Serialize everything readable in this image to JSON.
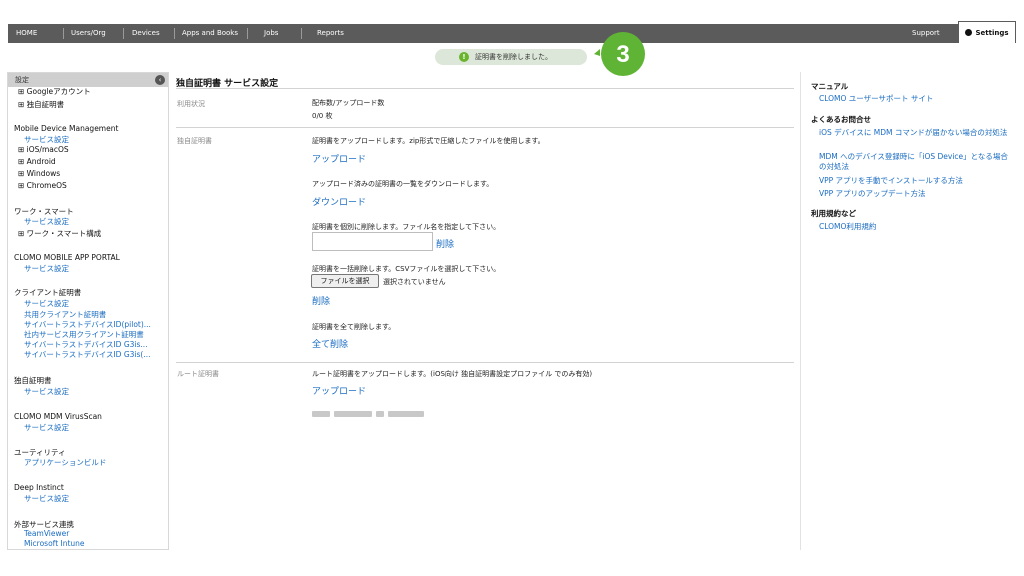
{
  "nav": {
    "items": [
      "HOME",
      "Users/Org",
      "Devices",
      "Apps and Books",
      "Jobs",
      "Reports"
    ],
    "support": "Support",
    "settings": "Settings"
  },
  "toast": {
    "message": "証明書を削除しました。",
    "step_number": "3",
    "accent": "#5fb335"
  },
  "sidebar": {
    "header": "設定",
    "lines": [
      {
        "text": "Googleアカウント",
        "kind": "tree"
      },
      {
        "text": "独自証明書",
        "kind": "tree"
      },
      {
        "text": "Mobile Device Management",
        "kind": "heading"
      },
      {
        "text": "サービス設定",
        "kind": "link"
      },
      {
        "text": "iOS/macOS",
        "kind": "tree"
      },
      {
        "text": "Android",
        "kind": "tree"
      },
      {
        "text": "Windows",
        "kind": "tree"
      },
      {
        "text": "ChromeOS",
        "kind": "tree"
      },
      {
        "text": "ワーク・スマート",
        "kind": "heading"
      },
      {
        "text": "サービス設定",
        "kind": "link"
      },
      {
        "text": "ワーク・スマート構成",
        "kind": "tree"
      },
      {
        "text": "CLOMO MOBILE APP PORTAL",
        "kind": "heading"
      },
      {
        "text": "サービス設定",
        "kind": "link"
      },
      {
        "text": "クライアント証明書",
        "kind": "heading"
      },
      {
        "text": "サービス設定",
        "kind": "link"
      },
      {
        "text": "共用クライアント証明書",
        "kind": "link"
      },
      {
        "text": "サイバートラストデバイスID(pilot)...",
        "kind": "link"
      },
      {
        "text": "社内サービス用クライアント証明書",
        "kind": "link"
      },
      {
        "text": "サイバートラストデバイスID G3is...",
        "kind": "link"
      },
      {
        "text": "サイバートラストデバイスID G3is(...",
        "kind": "link"
      },
      {
        "text": "独自証明書",
        "kind": "heading"
      },
      {
        "text": "サービス設定",
        "kind": "link"
      },
      {
        "text": "CLOMO MDM VirusScan",
        "kind": "heading"
      },
      {
        "text": "サービス設定",
        "kind": "link"
      },
      {
        "text": "ユーティリティ",
        "kind": "heading"
      },
      {
        "text": "アプリケーションビルド",
        "kind": "link"
      },
      {
        "text": "Deep Instinct",
        "kind": "heading"
      },
      {
        "text": "サービス設定",
        "kind": "link"
      },
      {
        "text": "外部サービス連携",
        "kind": "heading"
      },
      {
        "text": "TeamViewer",
        "kind": "link"
      },
      {
        "text": "Microsoft Intune",
        "kind": "link"
      }
    ]
  },
  "main": {
    "title": "独自証明書 サービス設定",
    "usage": {
      "label": "利用状況",
      "title": "配布数/アップロード数",
      "value": "0/0 枚"
    },
    "own_cert": {
      "label": "独自証明書",
      "upload_desc": "証明書をアップロードします。zip形式で圧縮したファイルを使用します。",
      "upload_link": "アップロード",
      "download_desc": "アップロード済みの証明書の一覧をダウンロードします。",
      "download_link": "ダウンロード",
      "delete_one_desc": "証明書を個別に削除します。ファイル名を指定して下さい。",
      "filename_value": "",
      "delete_one_link": "削除",
      "delete_bulk_desc": "証明書を一括削除します。CSVファイルを選択して下さい。",
      "choose_file": "ファイルを選択",
      "no_file": "選択されていません",
      "delete_bulk_link": "削除",
      "delete_all_desc": "証明書を全て削除します。",
      "delete_all_link": "全て削除"
    },
    "root_cert": {
      "label": "ルート証明書",
      "desc": "ルート証明書をアップロードします。(iOS向け 独自証明書設定プロファイル でのみ有効)",
      "upload_link": "アップロード"
    }
  },
  "right": {
    "manual": "マニュアル",
    "manual_link": "CLOMO ユーザーサポート サイト",
    "faq": "よくあるお問合せ",
    "faq_links": [
      "iOS デバイスに MDM コマンドが届かない場合の対処法",
      "MDM へのデバイス登録時に「iOS Device」となる場合の対処法",
      "VPP アプリを手動でインストールする方法",
      "VPP アプリのアップデート方法"
    ],
    "terms": "利用規約など",
    "terms_link": "CLOMO利用規約"
  }
}
